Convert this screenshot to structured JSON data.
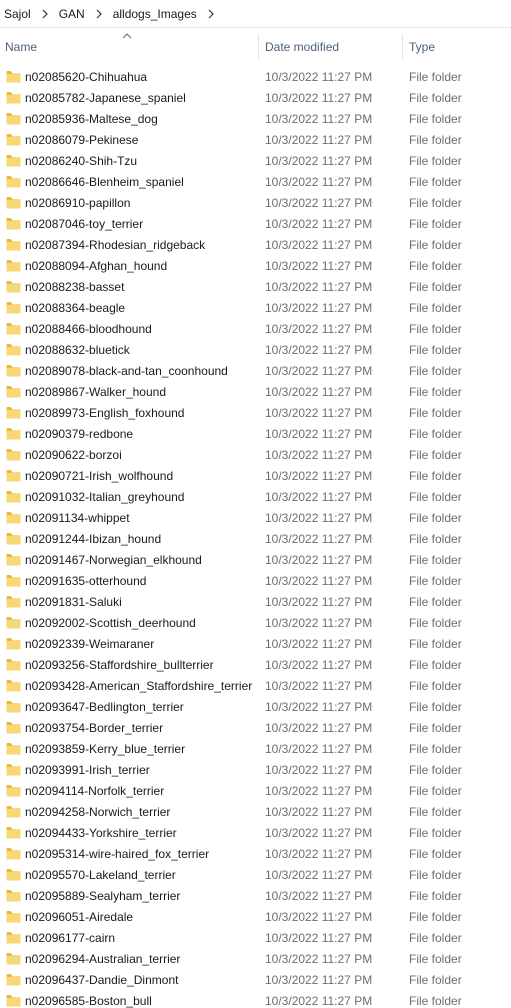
{
  "breadcrumb": [
    "l Sajol",
    "GAN",
    "alldogs_Images"
  ],
  "columns": {
    "name": "Name",
    "date": "Date modified",
    "type": "Type"
  },
  "icons": {
    "folder": "folder-icon",
    "separator": "chevron-right-icon",
    "sort": "sort-up-icon"
  },
  "colors": {
    "folder": "#f8d775",
    "folder_dark": "#e7b93c",
    "header_text": "#4c607a"
  },
  "rows": [
    {
      "name": "n02085620-Chihuahua",
      "date": "10/3/2022 11:27 PM",
      "type": "File folder"
    },
    {
      "name": "n02085782-Japanese_spaniel",
      "date": "10/3/2022 11:27 PM",
      "type": "File folder"
    },
    {
      "name": "n02085936-Maltese_dog",
      "date": "10/3/2022 11:27 PM",
      "type": "File folder"
    },
    {
      "name": "n02086079-Pekinese",
      "date": "10/3/2022 11:27 PM",
      "type": "File folder"
    },
    {
      "name": "n02086240-Shih-Tzu",
      "date": "10/3/2022 11:27 PM",
      "type": "File folder"
    },
    {
      "name": "n02086646-Blenheim_spaniel",
      "date": "10/3/2022 11:27 PM",
      "type": "File folder"
    },
    {
      "name": "n02086910-papillon",
      "date": "10/3/2022 11:27 PM",
      "type": "File folder"
    },
    {
      "name": "n02087046-toy_terrier",
      "date": "10/3/2022 11:27 PM",
      "type": "File folder"
    },
    {
      "name": "n02087394-Rhodesian_ridgeback",
      "date": "10/3/2022 11:27 PM",
      "type": "File folder"
    },
    {
      "name": "n02088094-Afghan_hound",
      "date": "10/3/2022 11:27 PM",
      "type": "File folder"
    },
    {
      "name": "n02088238-basset",
      "date": "10/3/2022 11:27 PM",
      "type": "File folder"
    },
    {
      "name": "n02088364-beagle",
      "date": "10/3/2022 11:27 PM",
      "type": "File folder"
    },
    {
      "name": "n02088466-bloodhound",
      "date": "10/3/2022 11:27 PM",
      "type": "File folder"
    },
    {
      "name": "n02088632-bluetick",
      "date": "10/3/2022 11:27 PM",
      "type": "File folder"
    },
    {
      "name": "n02089078-black-and-tan_coonhound",
      "date": "10/3/2022 11:27 PM",
      "type": "File folder"
    },
    {
      "name": "n02089867-Walker_hound",
      "date": "10/3/2022 11:27 PM",
      "type": "File folder"
    },
    {
      "name": "n02089973-English_foxhound",
      "date": "10/3/2022 11:27 PM",
      "type": "File folder"
    },
    {
      "name": "n02090379-redbone",
      "date": "10/3/2022 11:27 PM",
      "type": "File folder"
    },
    {
      "name": "n02090622-borzoi",
      "date": "10/3/2022 11:27 PM",
      "type": "File folder"
    },
    {
      "name": "n02090721-Irish_wolfhound",
      "date": "10/3/2022 11:27 PM",
      "type": "File folder"
    },
    {
      "name": "n02091032-Italian_greyhound",
      "date": "10/3/2022 11:27 PM",
      "type": "File folder"
    },
    {
      "name": "n02091134-whippet",
      "date": "10/3/2022 11:27 PM",
      "type": "File folder"
    },
    {
      "name": "n02091244-Ibizan_hound",
      "date": "10/3/2022 11:27 PM",
      "type": "File folder"
    },
    {
      "name": "n02091467-Norwegian_elkhound",
      "date": "10/3/2022 11:27 PM",
      "type": "File folder"
    },
    {
      "name": "n02091635-otterhound",
      "date": "10/3/2022 11:27 PM",
      "type": "File folder"
    },
    {
      "name": "n02091831-Saluki",
      "date": "10/3/2022 11:27 PM",
      "type": "File folder"
    },
    {
      "name": "n02092002-Scottish_deerhound",
      "date": "10/3/2022 11:27 PM",
      "type": "File folder"
    },
    {
      "name": "n02092339-Weimaraner",
      "date": "10/3/2022 11:27 PM",
      "type": "File folder"
    },
    {
      "name": "n02093256-Staffordshire_bullterrier",
      "date": "10/3/2022 11:27 PM",
      "type": "File folder"
    },
    {
      "name": "n02093428-American_Staffordshire_terrier",
      "date": "10/3/2022 11:27 PM",
      "type": "File folder"
    },
    {
      "name": "n02093647-Bedlington_terrier",
      "date": "10/3/2022 11:27 PM",
      "type": "File folder"
    },
    {
      "name": "n02093754-Border_terrier",
      "date": "10/3/2022 11:27 PM",
      "type": "File folder"
    },
    {
      "name": "n02093859-Kerry_blue_terrier",
      "date": "10/3/2022 11:27 PM",
      "type": "File folder"
    },
    {
      "name": "n02093991-Irish_terrier",
      "date": "10/3/2022 11:27 PM",
      "type": "File folder"
    },
    {
      "name": "n02094114-Norfolk_terrier",
      "date": "10/3/2022 11:27 PM",
      "type": "File folder"
    },
    {
      "name": "n02094258-Norwich_terrier",
      "date": "10/3/2022 11:27 PM",
      "type": "File folder"
    },
    {
      "name": "n02094433-Yorkshire_terrier",
      "date": "10/3/2022 11:27 PM",
      "type": "File folder"
    },
    {
      "name": "n02095314-wire-haired_fox_terrier",
      "date": "10/3/2022 11:27 PM",
      "type": "File folder"
    },
    {
      "name": "n02095570-Lakeland_terrier",
      "date": "10/3/2022 11:27 PM",
      "type": "File folder"
    },
    {
      "name": "n02095889-Sealyham_terrier",
      "date": "10/3/2022 11:27 PM",
      "type": "File folder"
    },
    {
      "name": "n02096051-Airedale",
      "date": "10/3/2022 11:27 PM",
      "type": "File folder"
    },
    {
      "name": "n02096177-cairn",
      "date": "10/3/2022 11:27 PM",
      "type": "File folder"
    },
    {
      "name": "n02096294-Australian_terrier",
      "date": "10/3/2022 11:27 PM",
      "type": "File folder"
    },
    {
      "name": "n02096437-Dandie_Dinmont",
      "date": "10/3/2022 11:27 PM",
      "type": "File folder"
    },
    {
      "name": "n02096585-Boston_bull",
      "date": "10/3/2022 11:27 PM",
      "type": "File folder"
    }
  ]
}
